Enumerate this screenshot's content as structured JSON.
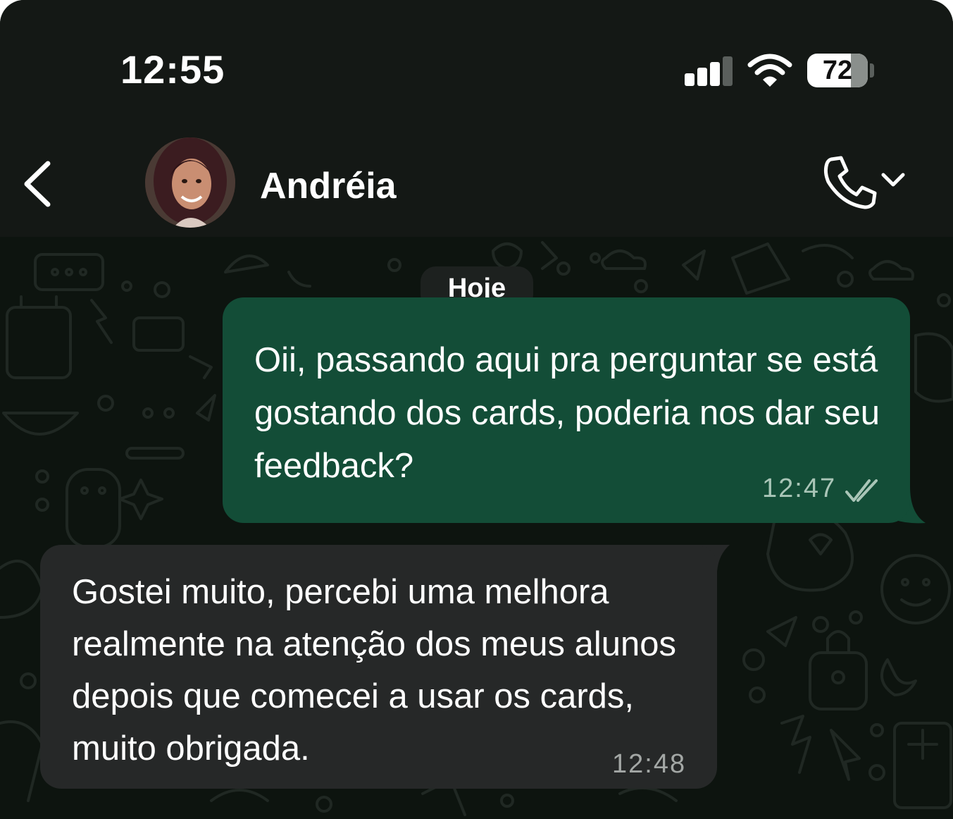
{
  "status_bar": {
    "time": "12:55",
    "battery": "72",
    "icons": [
      "signal-bars-icon",
      "wifi-icon",
      "battery-icon"
    ]
  },
  "header": {
    "back_icon": "chevron-left-icon",
    "contact_name": "Andréia",
    "call_icon": "phone-icon",
    "call_menu_icon": "chevron-down-icon"
  },
  "chat": {
    "date_label": "Hoje",
    "messages": [
      {
        "direction": "outgoing",
        "text": "Oii, passando aqui pra perguntar se está gostando dos cards, poderia nos dar seu feedback?",
        "time": "12:47",
        "status_icon": "double-check-icon"
      },
      {
        "direction": "incoming",
        "text": "Gostei muito, percebi uma melhora realmente na atenção dos meus alunos depois que comecei a usar os cards, muito obrigada.",
        "time": "12:48"
      }
    ]
  },
  "colors": {
    "outgoing_bubble": "#134d37",
    "incoming_bubble": "#262828",
    "header_bg": "#141815",
    "chat_bg": "#0d140f"
  }
}
